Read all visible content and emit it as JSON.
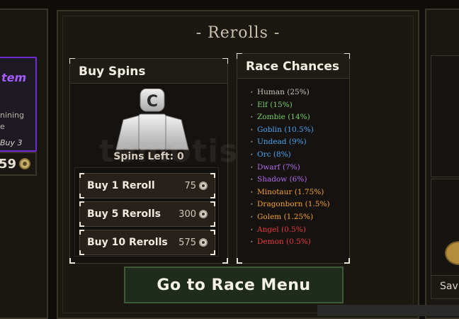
{
  "left_panel": {
    "item_title": "tem",
    "line1": "nining",
    "line2": "e",
    "line3": "Buy 3",
    "price": "59"
  },
  "main": {
    "title": "- Rerolls -"
  },
  "buy_spins": {
    "header": "Buy Spins",
    "spins_left": "Spins Left: 0",
    "buttons": [
      {
        "label": "Buy 1 Reroll",
        "price": "75"
      },
      {
        "label": "Buy 5 Rerolls",
        "price": "300"
      },
      {
        "label": "Buy 10 Rerolls",
        "price": "575"
      }
    ]
  },
  "race_chances": {
    "header": "Race Chances",
    "items": [
      {
        "text": "Human (25%)",
        "color": "#c9c4b8"
      },
      {
        "text": "Elf (15%)",
        "color": "#76d066"
      },
      {
        "text": "Zombie (14%)",
        "color": "#76d066"
      },
      {
        "text": "Goblin (10.5%)",
        "color": "#4aa3f0"
      },
      {
        "text": "Undead (9%)",
        "color": "#4aa3f0"
      },
      {
        "text": "Orc (8%)",
        "color": "#4aa3f0"
      },
      {
        "text": "Dwarf (7%)",
        "color": "#b36cf0"
      },
      {
        "text": "Shadow (6%)",
        "color": "#b36cf0"
      },
      {
        "text": "Minotaur (1.75%)",
        "color": "#f2a22a"
      },
      {
        "text": "Dragonborn (1.5%)",
        "color": "#f2a22a"
      },
      {
        "text": "Golem (1.25%)",
        "color": "#f2a22a"
      },
      {
        "text": "Angel (0.5%)",
        "color": "#ec3d3d"
      },
      {
        "text": "Demon (0.5%)",
        "color": "#ec3d3d"
      }
    ]
  },
  "race_menu_button": "Go to Race Menu",
  "right_panel": {
    "label": "Sav"
  },
  "watermark": "temotis",
  "icons": {
    "coin": "currency-coin-icon",
    "avatar": "roblox-avatar-icon"
  }
}
